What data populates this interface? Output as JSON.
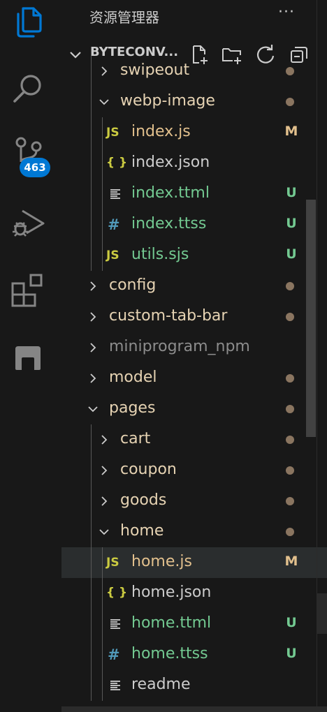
{
  "activity_bar": {
    "scm_badge": "463",
    "icons": [
      "explorer-icon",
      "search-icon",
      "source-control-icon",
      "run-debug-icon",
      "extensions-icon",
      "remote-explorer-icon"
    ]
  },
  "sidebar": {
    "title": "资源管理器",
    "more": "···",
    "section_title": "BYTECONV...",
    "actions": [
      "new-file-icon",
      "new-folder-icon",
      "refresh-icon",
      "collapse-all-icon"
    ]
  },
  "tree": [
    {
      "name": "swipeout",
      "kind": "folder",
      "level": 1,
      "expanded": false,
      "color": "folder",
      "deco": "dot"
    },
    {
      "name": "webp-image",
      "kind": "folder",
      "level": 1,
      "expanded": true,
      "color": "folder",
      "deco": "dot"
    },
    {
      "name": "index.js",
      "kind": "js",
      "level": 2,
      "color": "modified",
      "deco": "M"
    },
    {
      "name": "index.json",
      "kind": "json",
      "level": 2,
      "color": "default",
      "deco": ""
    },
    {
      "name": "index.ttml",
      "kind": "ttml",
      "level": 2,
      "color": "untracked",
      "deco": "U"
    },
    {
      "name": "index.ttss",
      "kind": "ttss",
      "level": 2,
      "color": "untracked",
      "deco": "U"
    },
    {
      "name": "utils.sjs",
      "kind": "js",
      "level": 2,
      "color": "untracked",
      "deco": "U"
    },
    {
      "name": "config",
      "kind": "folder",
      "level": 0,
      "expanded": false,
      "color": "folder",
      "deco": "dot"
    },
    {
      "name": "custom-tab-bar",
      "kind": "folder",
      "level": 0,
      "expanded": false,
      "color": "folder",
      "deco": "dot"
    },
    {
      "name": "miniprogram_npm",
      "kind": "folder",
      "level": 0,
      "expanded": false,
      "color": "dim",
      "deco": ""
    },
    {
      "name": "model",
      "kind": "folder",
      "level": 0,
      "expanded": false,
      "color": "folder",
      "deco": "dot"
    },
    {
      "name": "pages",
      "kind": "folder",
      "level": 0,
      "expanded": true,
      "color": "folder",
      "deco": "dot"
    },
    {
      "name": "cart",
      "kind": "folder",
      "level": 1,
      "expanded": false,
      "color": "folder",
      "deco": "dot"
    },
    {
      "name": "coupon",
      "kind": "folder",
      "level": 1,
      "expanded": false,
      "color": "folder",
      "deco": "dot"
    },
    {
      "name": "goods",
      "kind": "folder",
      "level": 1,
      "expanded": false,
      "color": "folder",
      "deco": "dot"
    },
    {
      "name": "home",
      "kind": "folder",
      "level": 1,
      "expanded": true,
      "color": "folder",
      "deco": "dot"
    },
    {
      "name": "home.js",
      "kind": "js",
      "level": 2,
      "color": "modified",
      "deco": "M",
      "selected": true
    },
    {
      "name": "home.json",
      "kind": "json",
      "level": 2,
      "color": "default",
      "deco": ""
    },
    {
      "name": "home.ttml",
      "kind": "ttml",
      "level": 2,
      "color": "untracked",
      "deco": "U"
    },
    {
      "name": "home.ttss",
      "kind": "ttss",
      "level": 2,
      "color": "untracked",
      "deco": "U"
    },
    {
      "name": "readme",
      "kind": "text",
      "level": 2,
      "color": "default",
      "deco": ""
    }
  ],
  "icon_glyphs": {
    "js": "JS",
    "json": "{ }",
    "ttss": "#"
  },
  "colors": {
    "background": "#181818",
    "folder": "#e6d3b3",
    "modified": "#e2c08d",
    "untracked": "#73c991",
    "default": "#cccccc",
    "dim": "#8c8c8c",
    "js_icon": "#cbcb41",
    "css_icon": "#519aba",
    "badge": "#0078d4",
    "selected_row": "#2a2d2e"
  }
}
